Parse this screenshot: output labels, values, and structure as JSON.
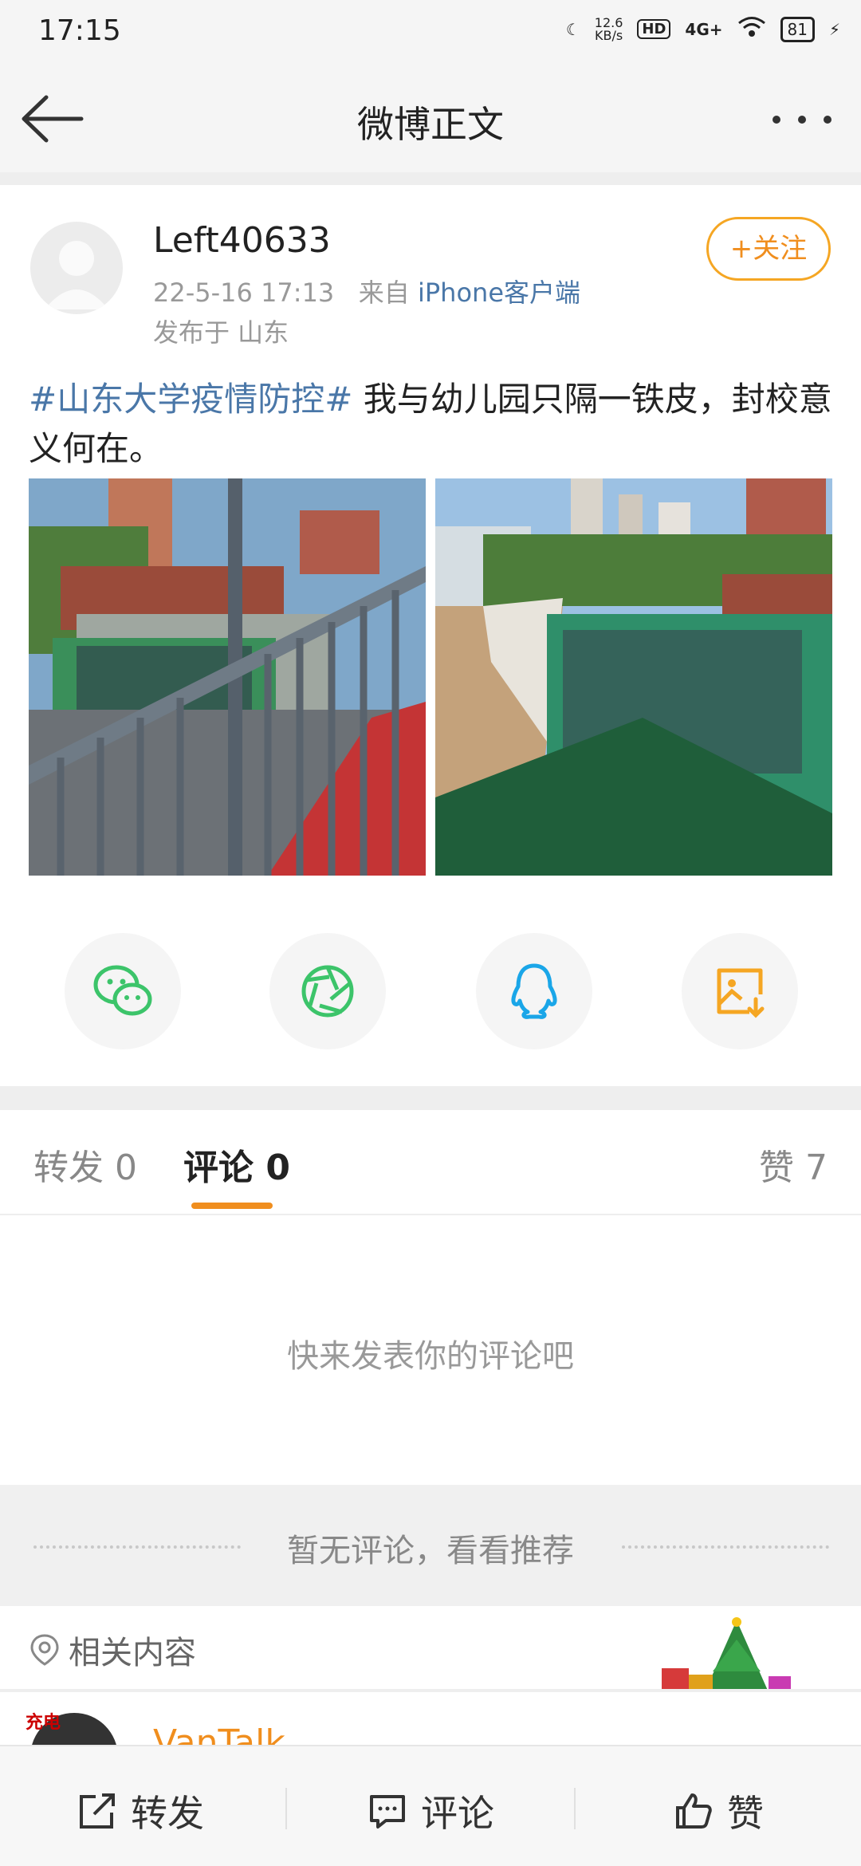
{
  "status_bar": {
    "time": "17:15",
    "net_speed_value": "12.6",
    "net_speed_unit": "KB/s",
    "hd": "HD",
    "network": "4G+",
    "battery": "81"
  },
  "header": {
    "title": "微博正文"
  },
  "post": {
    "username": "Left40633",
    "timestamp": "22-5-16 17:13",
    "source_prefix": "来自",
    "source": "iPhone客户端",
    "location": "发布于 山东",
    "follow_label": "+关注",
    "hashtag": "#山东大学疫情防控#",
    "text": " 我与幼儿园只隔一铁皮，封校意义何在。"
  },
  "share_icons": [
    "wechat-icon",
    "moments-icon",
    "qq-icon",
    "save-image-icon"
  ],
  "tabs": {
    "repost": "转发",
    "repost_count": "0",
    "comment": "评论",
    "comment_count": "0",
    "like": "赞",
    "like_count": "7"
  },
  "comments": {
    "empty_text": "快来发表你的评论吧"
  },
  "recommend": {
    "text": "暂无评论，看看推荐"
  },
  "related": {
    "label": "相关内容"
  },
  "related_item": {
    "name": "VanTalk",
    "badge": "充电"
  },
  "bottom_bar": {
    "repost": "转发",
    "comment": "评论",
    "like": "赞"
  },
  "colors": {
    "accent": "#f08e1e",
    "link": "#4a77a8",
    "wechat": "#3cc46a",
    "qq": "#1aa6e8"
  }
}
